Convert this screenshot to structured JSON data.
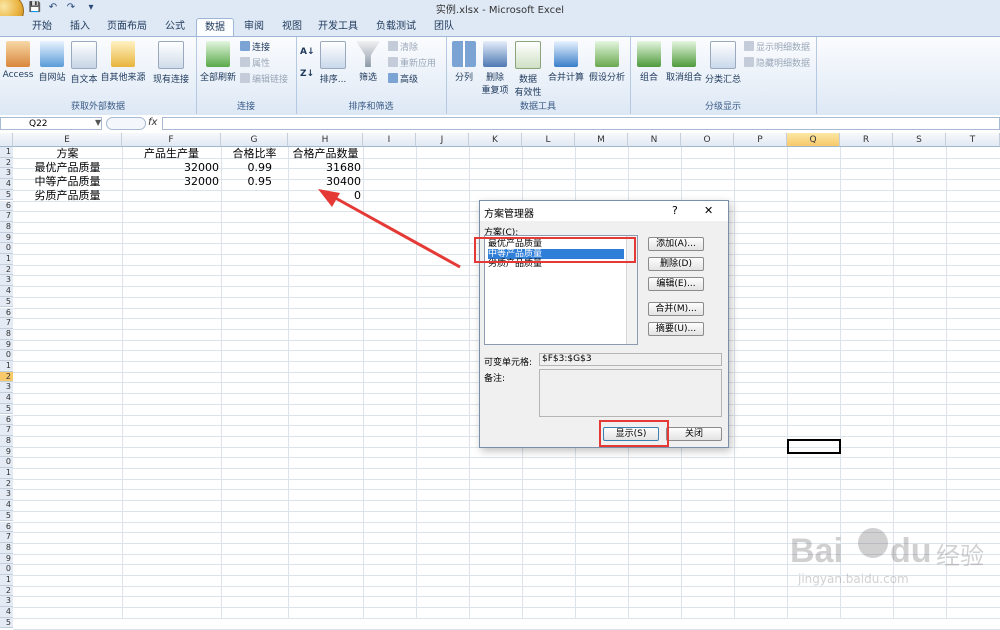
{
  "window": {
    "title": "实例.xlsx - Microsoft Excel"
  },
  "quick_access": {
    "save": "💾",
    "undo": "↶",
    "redo": "↷",
    "sep": "▾"
  },
  "tabs": [
    {
      "label": "开始"
    },
    {
      "label": "插入"
    },
    {
      "label": "页面布局"
    },
    {
      "label": "公式"
    },
    {
      "label": "数据",
      "active": true
    },
    {
      "label": "审阅"
    },
    {
      "label": "视图"
    },
    {
      "label": "开发工具"
    },
    {
      "label": "负载测试"
    },
    {
      "label": "团队"
    }
  ],
  "ribbon": {
    "external": {
      "label": "获取外部数据",
      "access": "Access",
      "web": "自网站",
      "text": "自文本",
      "other": "自其他来源",
      "existing": "现有连接"
    },
    "connections": {
      "label": "连接",
      "refresh": "全部刷新",
      "conn": "连接",
      "props": "属性",
      "edit": "编辑链接"
    },
    "sort": {
      "label": "排序和筛选",
      "sort": "排序...",
      "filter": "筛选",
      "clear": "清除",
      "reapply": "重新应用",
      "advanced": "高级"
    },
    "tools": {
      "label": "数据工具",
      "split": "分列",
      "dup1": "删除",
      "dup2": "重复项",
      "valid1": "数据",
      "valid2": "有效性",
      "consolidate": "合并计算",
      "whatif": "假设分析"
    },
    "outline": {
      "label": "分级显示",
      "group": "组合",
      "ungroup": "取消组合",
      "subtotal": "分类汇总",
      "show": "显示明细数据",
      "hide": "隐藏明细数据"
    }
  },
  "formula_bar": {
    "cell_ref": "Q22",
    "fx": "fx"
  },
  "columns": [
    "E",
    "F",
    "G",
    "H",
    "I",
    "J",
    "K",
    "L",
    "M",
    "N",
    "O",
    "P",
    "Q",
    "R",
    "S",
    "T"
  ],
  "rows": [
    "1",
    "2",
    "3",
    "4",
    "5",
    "6",
    "7",
    "8",
    "9",
    "0",
    "1",
    "2",
    "3",
    "4",
    "5",
    "6",
    "7",
    "8",
    "9",
    "0",
    "1",
    "2",
    "3",
    "4",
    "5",
    "6",
    "7",
    "8",
    "9",
    "0",
    "1",
    "2",
    "3",
    "4",
    "5",
    "6",
    "7",
    "8",
    "9",
    "0",
    "1",
    "2",
    "3",
    "4",
    "5"
  ],
  "sheet": {
    "header": [
      "方案",
      "产品生产量",
      "合格比率",
      "合格产品数量"
    ],
    "data": [
      [
        "最优产品质量",
        "32000",
        "0.99",
        "31680"
      ],
      [
        "中等产品质量",
        "32000",
        "0.95",
        "30400"
      ],
      [
        "劣质产品质量",
        "",
        "",
        "0"
      ]
    ]
  },
  "dialog": {
    "title": "方案管理器",
    "help": "?",
    "close": "✕",
    "list_label": "方案(C):",
    "items": [
      "最优产品质量",
      "中等产品质量",
      "劣质产品质量"
    ],
    "buttons": {
      "add": "添加(A)...",
      "delete": "删除(D)",
      "edit": "编辑(E)...",
      "merge": "合并(M)...",
      "summary": "摘要(U)..."
    },
    "changing_label": "可变单元格:",
    "changing_value": "$F$3:$G$3",
    "comment_label": "备注:",
    "show": "显示(S)",
    "close_btn": "关闭"
  },
  "watermark": {
    "brand": "Bai",
    "brand2": "du",
    "cn": "经验",
    "url": "jingyan.baidu.com"
  },
  "colors": {
    "accent": "#e53935",
    "selection": "#2f7ed8",
    "ribbon": "#dde8f5"
  }
}
